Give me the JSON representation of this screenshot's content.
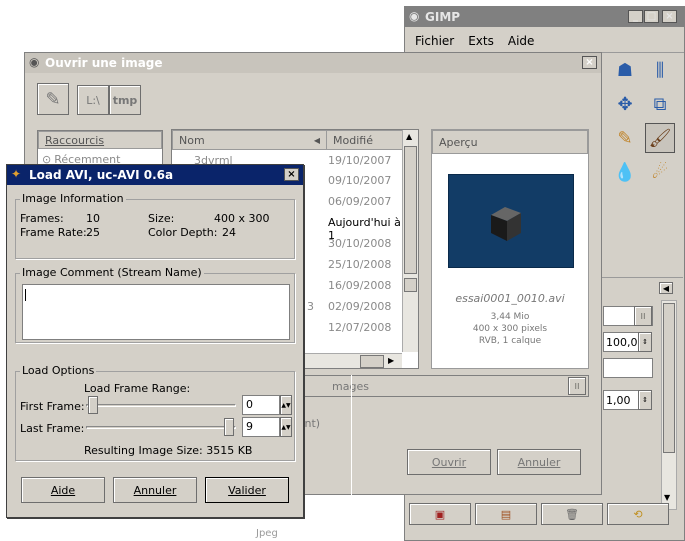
{
  "gimp": {
    "title": "GIMP",
    "menu": [
      "Fichier",
      "Exts",
      "Aide"
    ],
    "fields": {
      "opacity": "100,0",
      "scale": "1,00"
    }
  },
  "open_dialog": {
    "title": "Ouvrir une image",
    "path_buttons": [
      "L:\\",
      "tmp"
    ],
    "shortcuts_header": "Raccourcis",
    "shortcut_recent": "Récemment utilisés",
    "col_name": "Nom",
    "col_modified": "Modifié",
    "rows": [
      {
        "name": "3dvrml",
        "modified": "19/10/2007"
      },
      {
        "name": "",
        "modified": "09/10/2007"
      },
      {
        "name": "",
        "modified": "06/09/2007"
      },
      {
        "name": "",
        "modified": "Aujourd'hui à 1"
      },
      {
        "name": "",
        "modified": "30/10/2008"
      },
      {
        "name": "",
        "modified": "25/10/2008"
      },
      {
        "name": "",
        "modified": "16/09/2008"
      },
      {
        "name": "3",
        "modified": "02/09/2008"
      },
      {
        "name": "",
        "modified": "12/07/2008"
      }
    ],
    "filter_label": "mages",
    "type_label": "ment)",
    "preview_header": "Aperçu",
    "preview_filename": "essai0001_0010.avi",
    "preview_size": "3,44 Mio",
    "preview_dims": "400 x 300 pixels",
    "preview_mode": "RVB, 1 calque",
    "open_button": "Ouvrir",
    "cancel_button": "Annuler",
    "behind_text": "Jpeg"
  },
  "avi_dialog": {
    "title": "Load AVI, uc-AVI 0.6a",
    "info_title": "Image Information",
    "frames_label": "Frames:",
    "frames_value": "10",
    "size_label": "Size:",
    "size_value": "400 x 300",
    "framerate_label": "Frame Rate:",
    "framerate_value": "25",
    "depth_label": "Color Depth:",
    "depth_value": "24",
    "comment_title": "Image Comment (Stream Name)",
    "load_title": "Load Options",
    "range_label": "Load Frame Range:",
    "first_label": "First Frame:",
    "first_value": "0",
    "last_label": "Last Frame:",
    "last_value": "9",
    "result_text": "Resulting Image Size: 3515 KB",
    "help_button": "Aide",
    "cancel_button": "Annuler",
    "ok_button": "Valider"
  },
  "colors": {
    "titlebar_active": "#0a246a",
    "titlebar_inactive": "#808080",
    "preview_bg": "#123c66"
  }
}
